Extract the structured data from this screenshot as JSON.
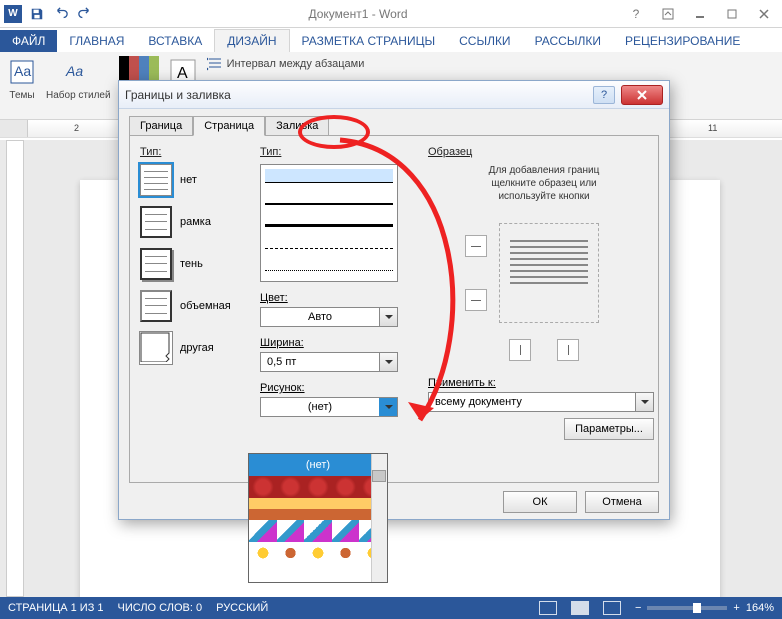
{
  "titlebar": {
    "title": "Документ1 - Word"
  },
  "ribbon_tabs": {
    "file": "ФАЙЛ",
    "home": "ГЛАВНАЯ",
    "insert": "ВСТАВКА",
    "design": "ДИЗАЙН",
    "layout": "РАЗМЕТКА СТРАНИЦЫ",
    "references": "ССЫЛКИ",
    "mailings": "РАССЫЛКИ",
    "review": "РЕЦЕНЗИРОВАНИЕ"
  },
  "ribbon": {
    "themes": "Темы",
    "style_set": "Набор стилей",
    "paragraph_spacing": "Интервал между абзацами"
  },
  "ruler": {
    "mark2": "2",
    "mark11": "11"
  },
  "dialog": {
    "title": "Границы и заливка",
    "tabs": {
      "border": "Граница",
      "page": "Страница",
      "fill": "Заливка"
    },
    "type_label": "Тип:",
    "types": {
      "none": "нет",
      "box": "рамка",
      "shadow": "тень",
      "threed": "объемная",
      "custom": "другая"
    },
    "style_label": "Тип:",
    "color_label": "Цвет:",
    "color_value": "Авто",
    "width_label": "Ширина:",
    "width_value": "0,5 пт",
    "art_label": "Рисунок:",
    "art_value": "(нет)",
    "preview_label": "Образец",
    "preview_help1": "Для добавления границ",
    "preview_help2": "щелкните образец или",
    "preview_help3": "используйте кнопки",
    "apply_label": "Применить к:",
    "apply_value": "всему документу",
    "params": "Параметры...",
    "ok": "ОК",
    "cancel": "Отмена",
    "dropdown": {
      "none": "(нет)"
    }
  },
  "statusbar": {
    "page": "СТРАНИЦА 1 ИЗ 1",
    "words": "ЧИСЛО СЛОВ: 0",
    "lang": "РУССКИЙ",
    "zoom": "164%"
  }
}
